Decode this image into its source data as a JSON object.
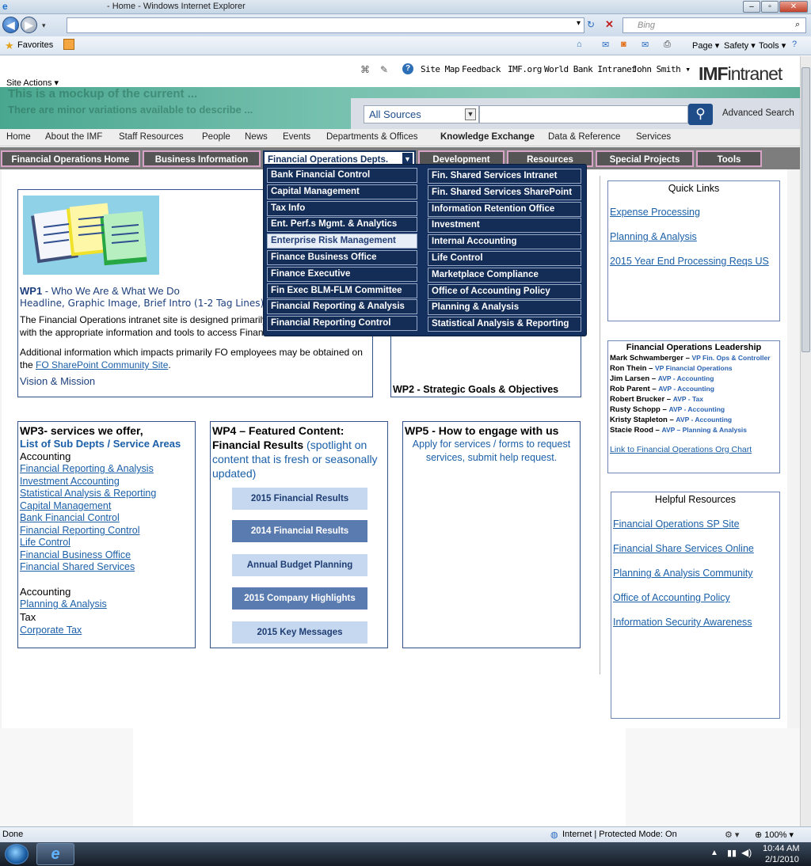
{
  "browser": {
    "window_title": "- Home - Windows Internet Explorer",
    "search_placeholder": "Bing",
    "favorites_label": "Favorites",
    "tools": {
      "page": "Page",
      "safety": "Safety",
      "tools": "Tools"
    },
    "status_left": "Done",
    "status_zone": "Internet | Protected Mode: On",
    "zoom": "100%",
    "clock_time": "10:44 AM",
    "clock_date": "2/1/2010"
  },
  "header": {
    "site_actions": "Site Actions",
    "top_links": [
      "Site Map",
      "Feedback",
      "IMF.org",
      "World Bank Intranet",
      "John Smith"
    ],
    "logo_bold": "IMF",
    "logo_light": "intranet",
    "ghost_line1": "This is a mockup of the current ...",
    "ghost_line2": "There are minor variations available to describe ...",
    "search_scope": "All Sources",
    "advanced_search": "Advanced Search"
  },
  "nav1": [
    "Home",
    "About the IMF",
    "Staff Resources",
    "People",
    "News",
    "Events",
    "Departments & Offices",
    "Knowledge Exchange",
    "Data & Reference",
    "Services"
  ],
  "nav2": [
    "Financial Operations Home",
    "Business Information",
    "Financial Operations Depts.",
    "Development",
    "Resources",
    "Special Projects",
    "Tools"
  ],
  "dropdown": {
    "left": [
      "Bank Financial Control",
      "Capital Management",
      "Tax Info",
      "Ent. Perf.s Mgmt. & Analytics",
      "Enterprise Risk Management",
      "Finance Business Office",
      "Finance Executive",
      "Fin Exec BLM-FLM Committee",
      "Financial Reporting & Analysis",
      "Financial Reporting Control"
    ],
    "right": [
      "Fin. Shared Services Intranet",
      "Fin. Shared Services SharePoint",
      "Information Retention Office",
      "Investment",
      "Internal Accounting",
      "Life Control",
      "Marketplace Compliance",
      "Office of Accounting Policy",
      "Planning & Analysis",
      "Statistical Analysis & Reporting"
    ]
  },
  "wp1": {
    "title_bold": "WP1",
    "title_rest": " - Who We Are & What We Do",
    "subtitle": "Headline, Graphic Image, Brief Intro (1-2 Tag Lines) Paragr",
    "para1a": "The Financial Operations intranet site is designed primarily",
    "para1b": "with the appropriate information and tools to access Financ",
    "para2a": "Additional information which impacts primarily FO employees may be obtained on",
    "para2b_pre": "the ",
    "para2b_link": "FO SharePoint Community Site",
    "para2b_post": ".",
    "vision": "Vision & Mission"
  },
  "wp2": {
    "title": "WP2 - Strategic Goals & Objectives"
  },
  "wp3": {
    "title": "WP3- services we offer,",
    "subtitle": "List of Sub Depts / Service Areas",
    "group1": "Accounting",
    "links1": [
      "Financial Reporting & Analysis",
      "Investment Accounting",
      "Statistical Analysis & Reporting",
      "Capital Management",
      "Bank Financial Control",
      "Financial Reporting Control",
      "Life Control",
      "Financial Business Office",
      "Financial Shared Services"
    ],
    "group2": "Accounting",
    "links2": [
      "Planning & Analysis"
    ],
    "group3": "Tax",
    "links3": [
      "Corporate Tax"
    ]
  },
  "wp4": {
    "title": "WP4 – Featured Content:",
    "subtitle_bold": "Financial Results",
    "subtitle_rest": " (spotlight on content that is fresh or seasonally updated)",
    "buttons": [
      "2015 Financial Results",
      "2014 Financial Results",
      "Annual Budget Planning",
      "2015 Company Highlights",
      "2015 Key Messages"
    ]
  },
  "wp5": {
    "title": "WP5 - How to engage with us",
    "body": "Apply for  services / forms to request services, submit help request."
  },
  "quick_links": {
    "title": "Quick Links",
    "links": [
      "Expense Processing",
      "Planning & Analysis",
      "2015 Year End Processing Reqs US"
    ]
  },
  "leadership": {
    "title": "Financial Operations Leadership",
    "people": [
      {
        "name": "Mark Schwamberger",
        "role": "VP Fin. Ops & Controller"
      },
      {
        "name": "Ron Thein",
        "role": "VP Financial Operations"
      },
      {
        "name": "Jim Larsen",
        "role": "AVP - Accounting"
      },
      {
        "name": "Rob Parent",
        "role": "AVP - Accounting"
      },
      {
        "name": "Robert Brucker",
        "role": "AVP - Tax"
      },
      {
        "name": "Rusty Schopp",
        "role": "AVP - Accounting"
      },
      {
        "name": "Kristy Stapleton",
        "role": "AVP - Accounting"
      },
      {
        "name": "Stacie Rood",
        "role": "AVP – Planning & Analysis"
      }
    ],
    "org_link": "Link to Financial Operations Org Chart"
  },
  "helpful": {
    "title": "Helpful Resources",
    "links": [
      "Financial Operations SP Site",
      "Financial Share Services Online",
      "Planning & Analysis Community",
      "Office of Accounting Policy",
      "Information Security Awareness"
    ]
  },
  "colors": {
    "accent": "#1a5fa8",
    "nav2_bg": "#555555",
    "dropdown_bg": "#142d57",
    "green_band": "#6cbba7"
  }
}
